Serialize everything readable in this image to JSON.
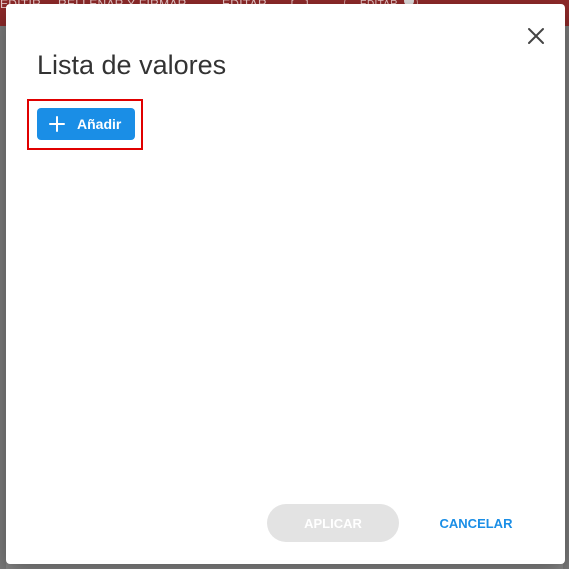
{
  "background": {
    "tabs": [
      "EDITIR",
      "RELLENAR Y FIRMAR",
      "EDITAR",
      "{...}",
      "EDITAR"
    ]
  },
  "dialog": {
    "title": "Lista de valores",
    "add_label": "Añadir",
    "apply_label": "APLICAR",
    "cancel_label": "CANCELAR"
  },
  "colors": {
    "primary": "#1a8ee6",
    "highlight": "#e00000",
    "disabled": "#e3e3e3"
  },
  "icons": {
    "close": "close-icon",
    "add": "plus-icon"
  }
}
